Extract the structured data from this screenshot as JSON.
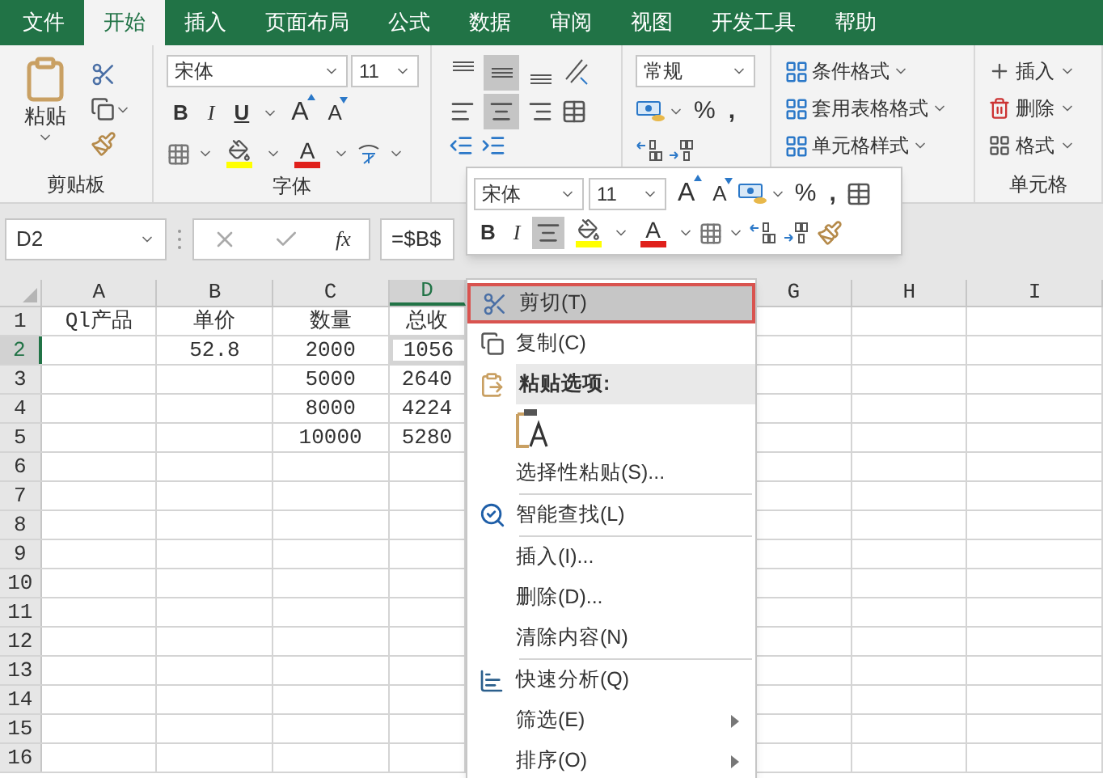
{
  "tabs": [
    {
      "label": "文件",
      "selected": false
    },
    {
      "label": "开始",
      "selected": true
    },
    {
      "label": "插入",
      "selected": false
    },
    {
      "label": "页面布局",
      "selected": false
    },
    {
      "label": "公式",
      "selected": false
    },
    {
      "label": "数据",
      "selected": false
    },
    {
      "label": "审阅",
      "selected": false
    },
    {
      "label": "视图",
      "selected": false
    },
    {
      "label": "开发工具",
      "selected": false
    },
    {
      "label": "帮助",
      "selected": false
    }
  ],
  "ribbon": {
    "clipboard": {
      "paste": "粘贴",
      "label": "剪贴板"
    },
    "font": {
      "name": "宋体",
      "size": "11",
      "bold": "B",
      "italic": "I",
      "underline": "U",
      "grow": "A",
      "shrink": "A",
      "font_color": "A",
      "label": "字体"
    },
    "alignment": {
      "vertical": [
        {
          "kind": "top",
          "selected": false
        },
        {
          "kind": "middle",
          "selected": true
        },
        {
          "kind": "bottom",
          "selected": false
        }
      ],
      "horizontal": [
        {
          "kind": "left",
          "selected": false
        },
        {
          "kind": "center",
          "selected": true
        },
        {
          "kind": "right",
          "selected": false
        }
      ]
    },
    "number": {
      "format": "常规",
      "percent": "%",
      "comma": ","
    },
    "styles": [
      {
        "label": "条件格式"
      },
      {
        "label": "套用表格格式"
      },
      {
        "label": "单元格样式"
      }
    ],
    "cells": {
      "items": [
        {
          "label": "插入"
        },
        {
          "label": "删除"
        },
        {
          "label": "格式"
        }
      ],
      "label": "单元格"
    }
  },
  "formula_bar": {
    "name_box": "D2",
    "function_label": "fx",
    "formula": "=$B$"
  },
  "mini_toolbar": {
    "font": "宋体",
    "size": "11",
    "grow": "A",
    "shrink": "A",
    "percent": "%",
    "comma": ",",
    "bold": "B",
    "italic": "I",
    "center_selected": true,
    "font_color": "A"
  },
  "sheet": {
    "columns": [
      {
        "label": "A",
        "selected": false
      },
      {
        "label": "B",
        "selected": false
      },
      {
        "label": "C",
        "selected": false
      },
      {
        "label": "D",
        "selected": true
      },
      {
        "label": "G",
        "selected": false
      },
      {
        "label": "H",
        "selected": false
      },
      {
        "label": "I",
        "selected": false
      }
    ],
    "rows": [
      {
        "label": "1",
        "selected": false,
        "cells": [
          "Ql产品",
          "单价",
          "数量",
          "总收"
        ]
      },
      {
        "label": "2",
        "selected": true,
        "cells": [
          null,
          "52.8",
          "2000",
          "1056"
        ]
      },
      {
        "label": "3",
        "selected": false,
        "cells": [
          null,
          null,
          "5000",
          "2640"
        ]
      },
      {
        "label": "4",
        "selected": false,
        "cells": [
          null,
          null,
          "8000",
          "4224"
        ]
      },
      {
        "label": "5",
        "selected": false,
        "cells": [
          null,
          null,
          "10000",
          "5280"
        ]
      },
      {
        "label": "6",
        "selected": false,
        "cells": []
      },
      {
        "label": "7",
        "selected": false,
        "cells": []
      },
      {
        "label": "8",
        "selected": false,
        "cells": []
      },
      {
        "label": "9",
        "selected": false,
        "cells": []
      },
      {
        "label": "10",
        "selected": false,
        "cells": []
      },
      {
        "label": "11",
        "selected": false,
        "cells": []
      },
      {
        "label": "12",
        "selected": false,
        "cells": []
      },
      {
        "label": "13",
        "selected": false,
        "cells": []
      },
      {
        "label": "14",
        "selected": false,
        "cells": []
      },
      {
        "label": "15",
        "selected": false,
        "cells": []
      },
      {
        "label": "16",
        "selected": false,
        "cells": []
      }
    ]
  },
  "context_menu": {
    "items": [
      {
        "kind": "item",
        "label": "剪切(T)",
        "selected": true,
        "divider_after": false,
        "submenu": false
      },
      {
        "kind": "item",
        "label": "复制(C)",
        "selected": false,
        "divider_after": false,
        "submenu": false
      },
      {
        "kind": "header",
        "label": "粘贴选项:",
        "selected": false,
        "divider_after": false,
        "submenu": false
      },
      {
        "kind": "paste_option",
        "selected": false,
        "divider_after": false,
        "submenu": false
      },
      {
        "kind": "item",
        "label": "选择性粘贴(S)...",
        "selected": false,
        "divider_after": true,
        "submenu": false
      },
      {
        "kind": "item",
        "label": "智能查找(L)",
        "selected": false,
        "divider_after": true,
        "submenu": false
      },
      {
        "kind": "item",
        "label": "插入(I)...",
        "selected": false,
        "divider_after": false,
        "submenu": false
      },
      {
        "kind": "item",
        "label": "删除(D)...",
        "selected": false,
        "divider_after": false,
        "submenu": false
      },
      {
        "kind": "item",
        "label": "清除内容(N)",
        "selected": false,
        "divider_after": true,
        "submenu": false
      },
      {
        "kind": "item",
        "label": "快速分析(Q)",
        "selected": false,
        "divider_after": false,
        "submenu": false
      },
      {
        "kind": "item",
        "label": "筛选(E)",
        "selected": false,
        "divider_after": false,
        "submenu": true
      },
      {
        "kind": "item",
        "label": "排序(O)",
        "selected": false,
        "divider_after": false,
        "submenu": true
      }
    ]
  }
}
